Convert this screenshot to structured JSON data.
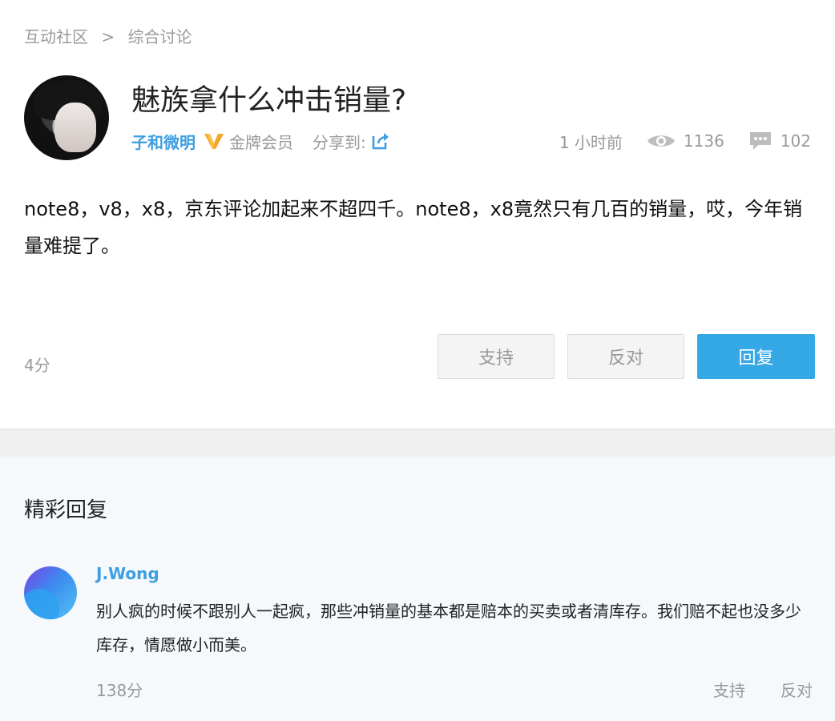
{
  "breadcrumb": {
    "root": "互动社区",
    "separator": ">",
    "current": "综合讨论"
  },
  "post": {
    "title": "魅族拿什么冲击销量?",
    "author": "子和微明",
    "badge_icon": "v-badge-icon",
    "member_level": "金牌会员",
    "share_label": "分享到:",
    "time": "1 小时前",
    "views": "1136",
    "comments": "102",
    "body": "note8，v8，x8，京东评论加起来不超四千。note8，x8竟然只有几百的销量，哎，今年销量难提了。",
    "score": "4分",
    "buttons": {
      "support": "支持",
      "oppose": "反对",
      "reply": "回复"
    }
  },
  "featured_replies": {
    "title": "精彩回复",
    "items": [
      {
        "author": "J.Wong",
        "text": "别人疯的时候不跟别人一起疯，那些冲销量的基本都是赔本的买卖或者清库存。我们赔不起也没多少库存，情愿做小而美。",
        "score": "138分",
        "support": "支持",
        "oppose": "反对"
      }
    ]
  },
  "colors": {
    "accent": "#35a8e6",
    "link": "#3d9ee0",
    "badge": "#f5a623",
    "muted": "#999999"
  }
}
